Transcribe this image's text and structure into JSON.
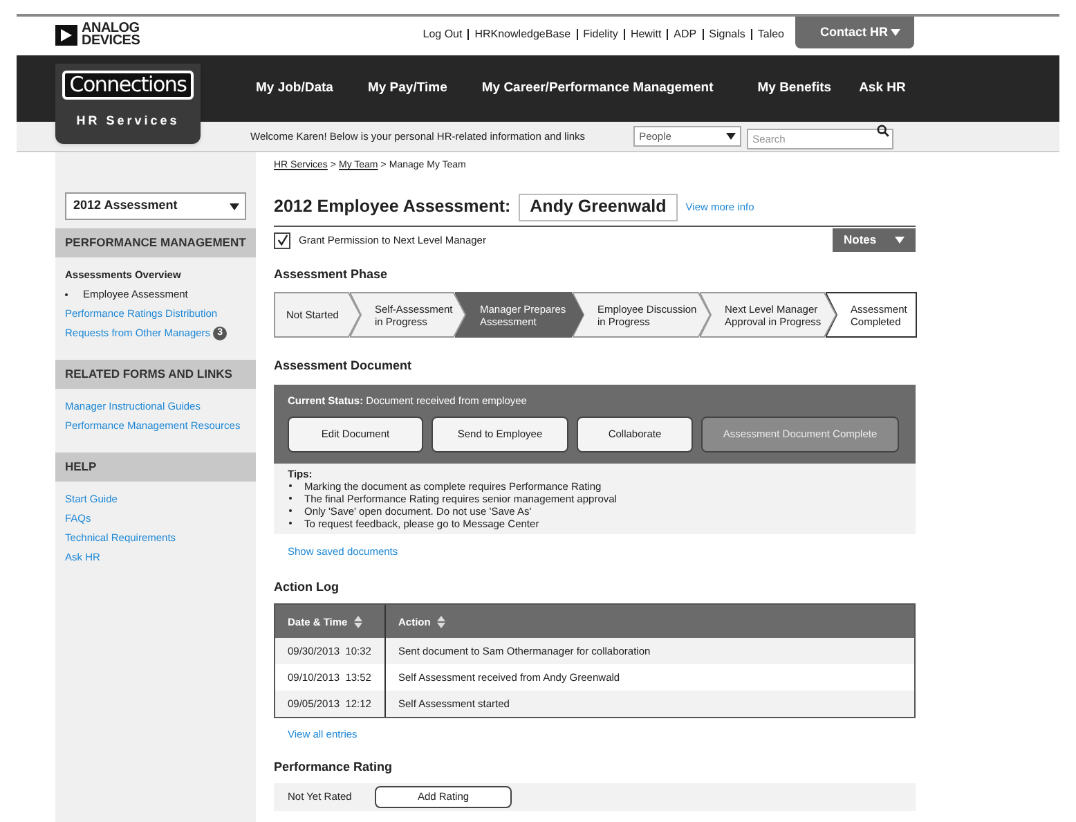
{
  "header": {
    "logo": "ANALOG DEVICES",
    "links": [
      "Log Out",
      "HRKnowledgeBase",
      "Fidelity",
      "Hewitt",
      "ADP",
      "Signals",
      "Taleo"
    ],
    "contact_button": "Contact HR"
  },
  "brand": {
    "title": "Connections",
    "subtitle": "HR Services"
  },
  "nav": [
    "My Job/Data",
    "My Pay/Time",
    "My Career/Performance Management",
    "My Benefits",
    "Ask HR"
  ],
  "welcome": "Welcome Karen! Below is your personal HR-related information and links",
  "people_select": "People",
  "search": {
    "placeholder": "Search"
  },
  "sidebar": {
    "selector": "2012 Assessment",
    "sections": [
      {
        "title": "PERFORMANCE MANAGEMENT",
        "items": [
          {
            "label": "Assessments Overview",
            "kind": "current"
          },
          {
            "label": "Employee Assessment",
            "kind": "bullet"
          },
          {
            "label": "Performance Ratings Distribution",
            "kind": "link"
          },
          {
            "label": "Requests from Other Managers",
            "kind": "link",
            "badge": "3"
          }
        ]
      },
      {
        "title": "RELATED FORMS AND LINKS",
        "items": [
          {
            "label": "Manager Instructional Guides",
            "kind": "link"
          },
          {
            "label": "Performance Management Resources",
            "kind": "link"
          }
        ]
      },
      {
        "title": "HELP",
        "items": [
          {
            "label": "Start Guide",
            "kind": "link"
          },
          {
            "label": "FAQs",
            "kind": "link"
          },
          {
            "label": "Technical Requirements",
            "kind": "link"
          },
          {
            "label": "Ask HR",
            "kind": "link"
          }
        ]
      }
    ]
  },
  "breadcrumb": {
    "separator": ">",
    "items": [
      {
        "label": "HR Services",
        "link": true
      },
      {
        "label": "My Team",
        "link": true
      },
      {
        "label": "Manage My Team",
        "link": false
      }
    ]
  },
  "title": "2012 Employee Assessment:",
  "employee": "Andy Greenwald",
  "more_link": "View more info",
  "permission": {
    "label": "Grant Permission to Next Level Manager",
    "checked": true
  },
  "notes_button": "Notes",
  "phase": {
    "title": "Assessment Phase",
    "steps": [
      {
        "label": "Not Started",
        "selected": false
      },
      {
        "label": "Self-Assessment in Progress",
        "selected": false
      },
      {
        "label": "Manager Prepares Assessment",
        "selected": true
      },
      {
        "label": "Employee Discussion in Progress",
        "selected": false
      },
      {
        "label": "Next Level Manager Approval in Progress",
        "selected": false
      },
      {
        "label": "Assessment Completed",
        "selected": false
      }
    ]
  },
  "document": {
    "title": "Assessment Document",
    "status_label": "Current Status:",
    "status": "Document received from employee",
    "buttons": [
      {
        "label": "Edit Document",
        "disabled": false
      },
      {
        "label": "Send to Employee",
        "disabled": false
      },
      {
        "label": "Collaborate",
        "disabled": false
      },
      {
        "label": "Assessment Document Complete",
        "disabled": true
      }
    ],
    "tips_title": "Tips:",
    "tips": [
      "Marking the document as complete requires Performance Rating",
      "The final Performance Rating requires senior management approval",
      "Only 'Save' open document. Do not use 'Save As'",
      "To request feedback, please go to Message Center"
    ],
    "saved_link": "Show saved documents"
  },
  "action_log": {
    "title": "Action Log",
    "columns": [
      "Date & Time",
      "Action"
    ],
    "rows": [
      [
        "09/30/2013  10:32",
        "Sent document to Sam Othermanager for collaboration"
      ],
      [
        "09/10/2013  13:52",
        "Self Assessment received from Andy Greenwald"
      ],
      [
        "09/05/2013  12:12",
        "Self Assessment started"
      ]
    ],
    "more_link": "View all entries"
  },
  "rating": {
    "title": "Performance Rating",
    "status": "Not Yet Rated",
    "button": "Add Rating"
  }
}
